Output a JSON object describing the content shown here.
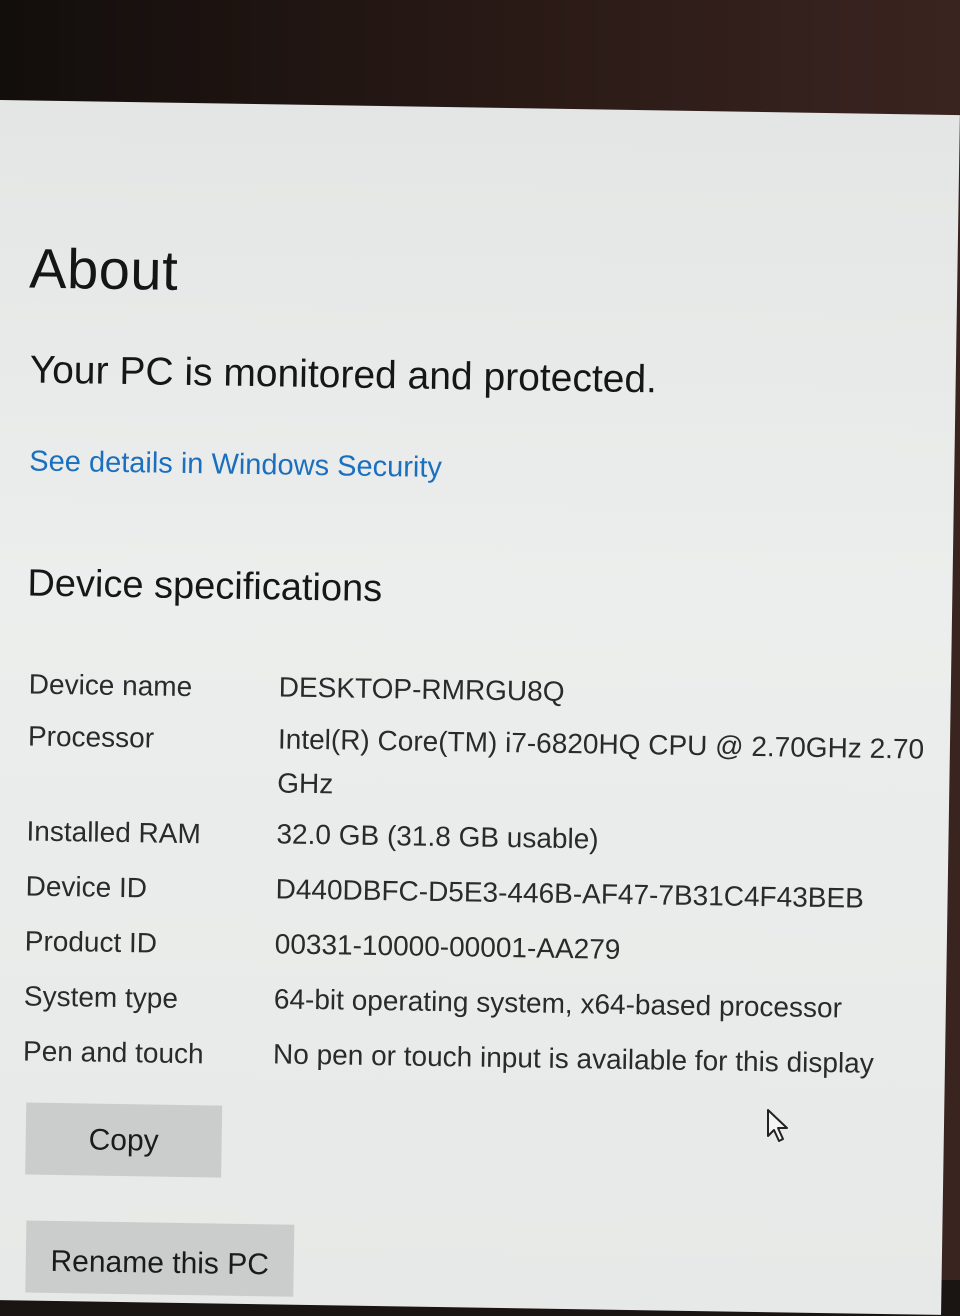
{
  "page": {
    "title": "About",
    "status": "Your PC is monitored and protected.",
    "security_link": "See details in Windows Security"
  },
  "specs": {
    "heading": "Device specifications",
    "rows": [
      {
        "label": "Device name",
        "value": "DESKTOP-RMRGU8Q"
      },
      {
        "label": "Processor",
        "value": "Intel(R) Core(TM) i7-6820HQ CPU @ 2.70GHz   2.70 GHz"
      },
      {
        "label": "Installed RAM",
        "value": "32.0 GB (31.8 GB usable)"
      },
      {
        "label": "Device ID",
        "value": "D440DBFC-D5E3-446B-AF47-7B31C4F43BEB"
      },
      {
        "label": "Product ID",
        "value": "00331-10000-00001-AA279"
      },
      {
        "label": "System type",
        "value": "64-bit operating system, x64-based processor"
      },
      {
        "label": "Pen and touch",
        "value": "No pen or touch input is available for this display"
      }
    ]
  },
  "actions": {
    "copy_label": "Copy",
    "rename_label": "Rename this PC"
  },
  "icons": {
    "cursor": "mouse-pointer-icon"
  },
  "colors": {
    "link": "#1a6fbf",
    "button_bg": "#cbcdcc",
    "background": "#e9ebea"
  }
}
